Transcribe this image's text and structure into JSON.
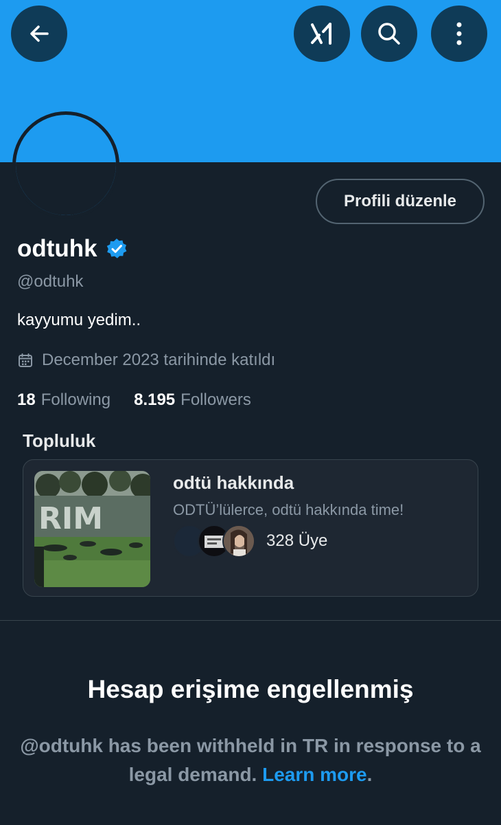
{
  "header": {
    "back_icon": "arrow-left-icon",
    "grok_icon": "grok-icon",
    "search_icon": "search-icon",
    "more_icon": "more-vertical-icon",
    "banner_color": "#1d9bf0"
  },
  "profile": {
    "edit_label": "Profili düzenle",
    "name": "odtuhk",
    "verified_icon": "verified-badge-icon",
    "handle": "@odtuhk",
    "bio": "kayyumu yedim..",
    "calendar_icon": "calendar-icon",
    "joined": "December 2023 tarihinde katıldı",
    "following_count": "18",
    "following_label": "Following",
    "followers_count": "8.195",
    "followers_label": "Followers"
  },
  "community": {
    "heading": "Topluluk",
    "title": "odtü hakkında",
    "description": "ODTÜ’lülerce, odtü hakkında time!",
    "members": "328 Üye"
  },
  "withheld": {
    "title": "Hesap erişime engellenmiş",
    "text": "@odtuhk has been withheld in TR in response to a legal demand.",
    "learn_more": "Learn more",
    "period": "."
  },
  "colors": {
    "background": "#15202b",
    "accent": "#1d9bf0",
    "muted_text": "#8b98a5"
  }
}
